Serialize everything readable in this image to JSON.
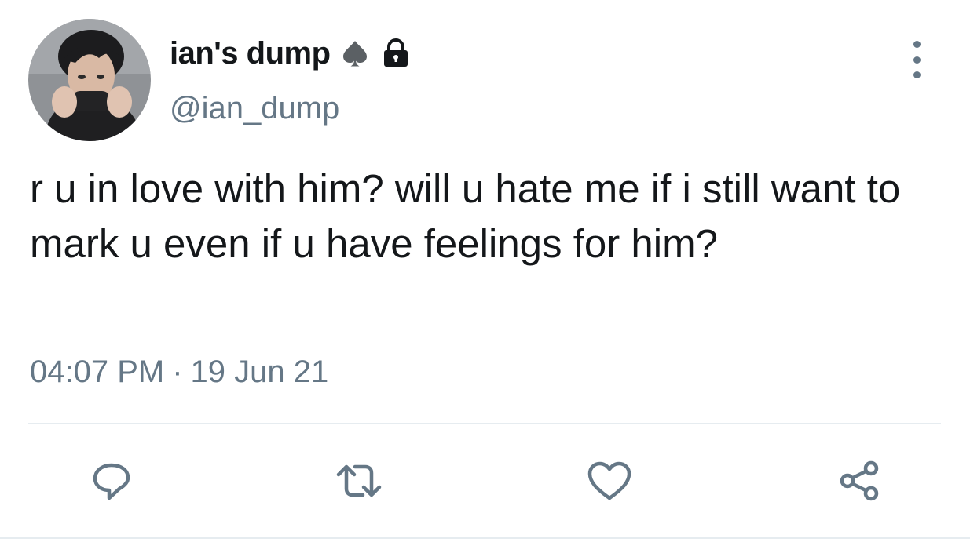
{
  "tweet": {
    "display_name": "ian's dump",
    "handle": "@ian_dump",
    "text": "r u in love with him? will u hate me if i still want to mark u even if u have feelings for him?",
    "time": "04:07 PM",
    "separator": "·",
    "date": "19 Jun 21"
  },
  "icons": {
    "badge_one": "spade-icon",
    "badge_two": "lock-icon",
    "more": "more-vertical-icon",
    "reply": "reply-icon",
    "retweet": "retweet-icon",
    "like": "heart-icon",
    "share": "share-icon"
  },
  "colors": {
    "text_primary": "#14171a",
    "text_secondary": "#657786",
    "divider": "#e6ecf0",
    "background": "#ffffff"
  }
}
